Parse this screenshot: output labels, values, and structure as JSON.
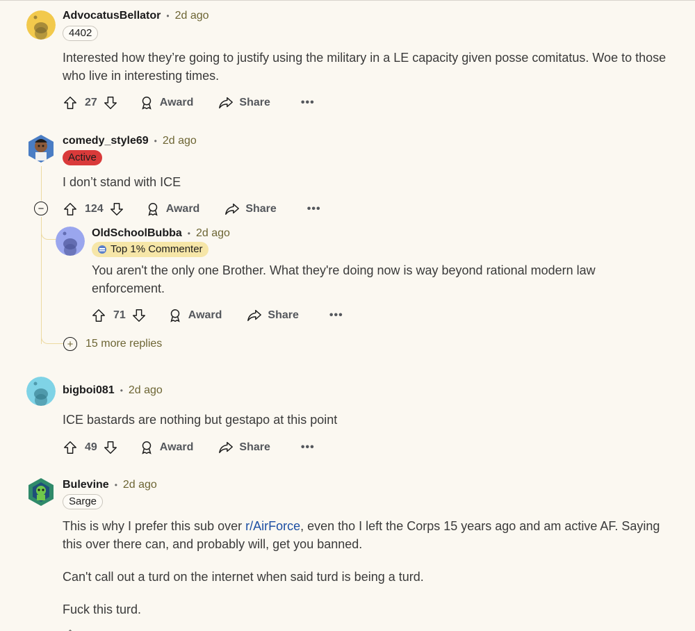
{
  "comments": [
    {
      "username": "AdvocatusBellator",
      "time": "2d ago",
      "flair": "4402",
      "text": "Interested how they’re going to justify using the military in a LE capacity given posse comitatus. Woe to those who live in interesting times.",
      "votes": "27",
      "award_label": "Award",
      "share_label": "Share",
      "avatar_color": "#f2c94c"
    },
    {
      "username": "comedy_style69",
      "time": "2d ago",
      "flair": "Active",
      "text": "I don’t stand with ICE",
      "votes": "124",
      "award_label": "Award",
      "share_label": "Share",
      "avatar_color": "#4a7dc4"
    },
    {
      "username": "OldSchoolBubba",
      "time": "2d ago",
      "flair": "Top 1% Commenter",
      "text": "You aren't the only one Brother. What they're doing now is way beyond rational modern law enforcement.",
      "votes": "71",
      "award_label": "Award",
      "share_label": "Share",
      "avatar_color": "#9aa6ee"
    },
    {
      "username": "bigboi081",
      "time": "2d ago",
      "text": "ICE bastards are nothing but gestapo at this point",
      "votes": "49",
      "award_label": "Award",
      "share_label": "Share",
      "avatar_color": "#7fd3e6"
    },
    {
      "username": "Bulevine",
      "time": "2d ago",
      "flair": "Sarge",
      "text_part1": "This is why I prefer this sub over ",
      "link": "r/AirForce",
      "text_part2": ", even tho I left the Corps 15 years ago and am active AF. Saying this over there can, and probably will, get you banned.",
      "paragraph2": "Can't call out a turd on the internet when said turd is being a turd.",
      "paragraph3": "Fuck this turd.",
      "avatar_color": "#2f8a6a"
    }
  ],
  "more_replies": "15 more replies",
  "colors": {
    "background": "#fbf8f1",
    "time_text": "#6d6534",
    "thread_line": "#ecd9a0",
    "active_flair": "#d93a3a",
    "top_commenter_flair": "#f6e6a8",
    "link": "#1d4fa3"
  },
  "icons": [
    "upvote-icon",
    "downvote-icon",
    "award-icon",
    "share-icon",
    "more-options-icon",
    "collapse-icon",
    "expand-icon"
  ]
}
